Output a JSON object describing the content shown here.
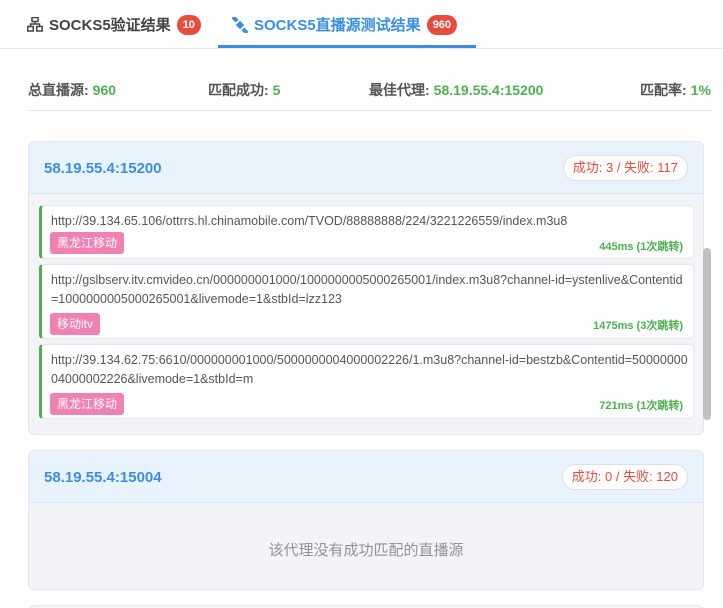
{
  "tabs": [
    {
      "icon": "network-icon",
      "label": "SOCKS5验证结果",
      "count": "10",
      "active": false
    },
    {
      "icon": "satellite-icon",
      "label": "SOCKS5直播源测试结果",
      "count": "960",
      "active": true
    }
  ],
  "stats": {
    "total_label": "总直播源:",
    "total_value": "960",
    "matched_label": "匹配成功:",
    "matched_value": "5",
    "best_label": "最佳代理:",
    "best_value": "58.19.55.4:15200",
    "rate_label": "匹配率:",
    "rate_value": "1%"
  },
  "proxies": [
    {
      "address": "58.19.55.4:15200",
      "result": "成功: 3 / 失败: 117",
      "sources": [
        {
          "url": "http://39.134.65.106/ottrrs.hl.chinamobile.com/TVOD/88888888/224/3221226559/index.m3u8",
          "tag": "黑龙江移动",
          "time": "445ms (1次跳转)"
        },
        {
          "url": "http://gslbserv.itv.cmvideo.cn/000000001000/1000000005000265001/index.m3u8?channel-id=ystenlive&Contentid=1000000005000265001&livemode=1&stbId=lzz123",
          "tag": "移动itv",
          "time": "1475ms (3次跳转)"
        },
        {
          "url": "http://39.134.62.75:6610/000000001000/5000000004000002226/1.m3u8?channel-id=bestzb&Contentid=5000000004000002226&livemode=1&stbId=m",
          "tag": "黑龙江移动",
          "time": "721ms (1次跳转)"
        }
      ]
    },
    {
      "address": "58.19.55.4:15004",
      "result": "成功: 0 / 失败: 120",
      "empty_message": "该代理没有成功匹配的直播源"
    }
  ]
}
